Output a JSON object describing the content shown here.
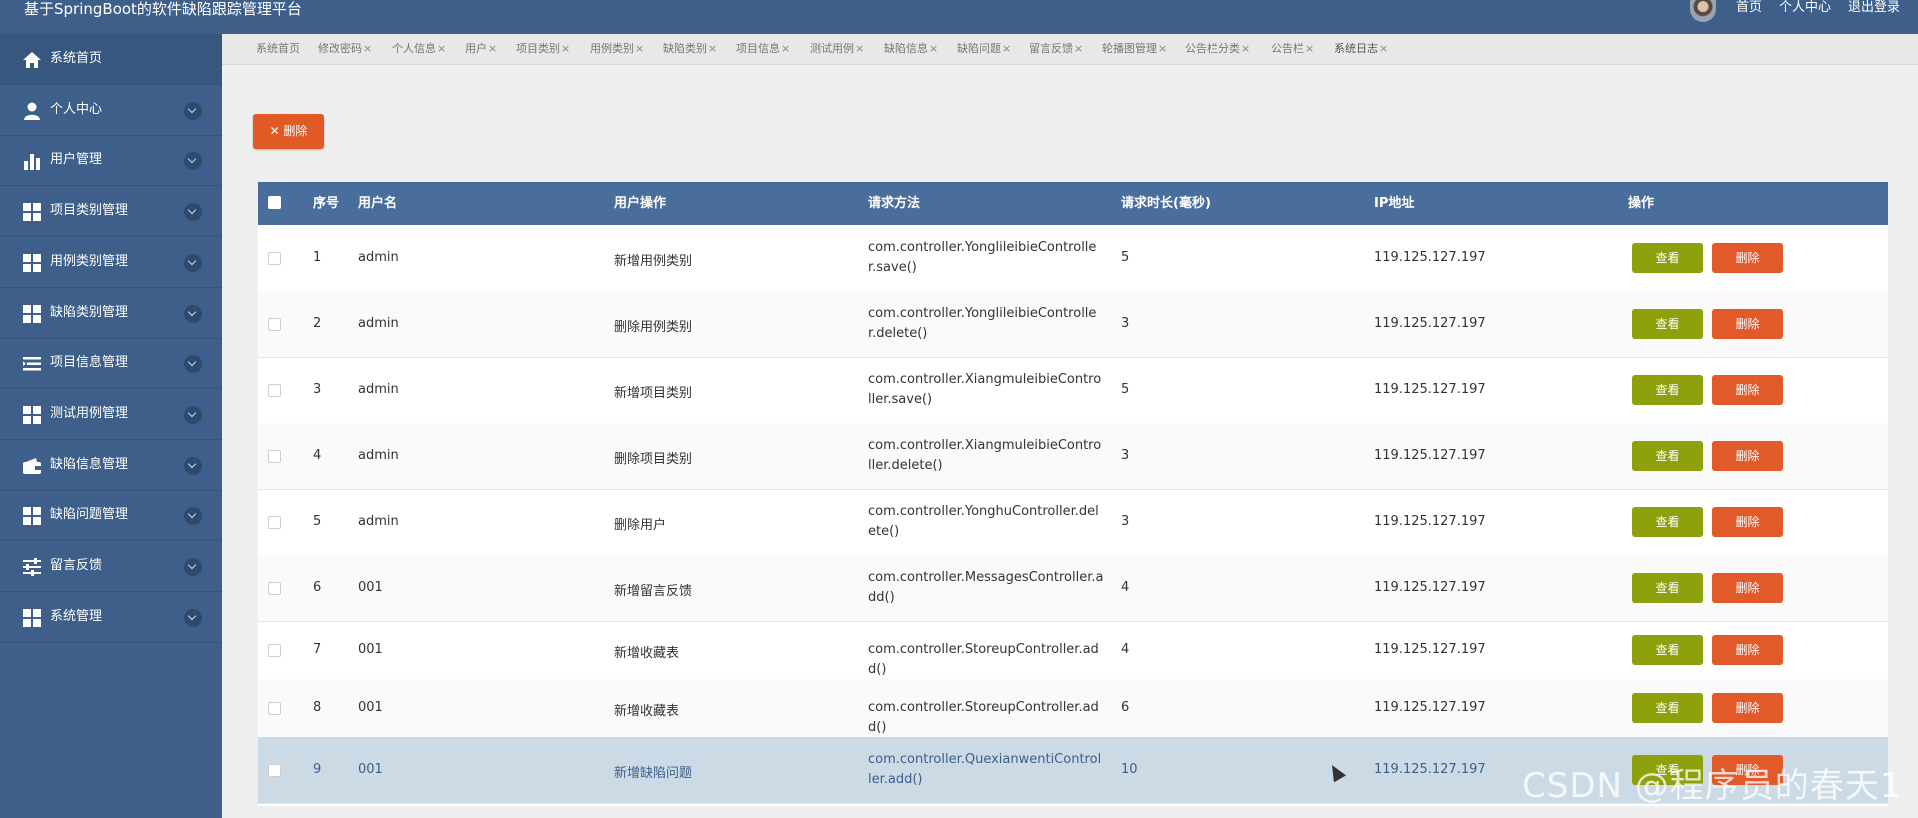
{
  "app": {
    "title": "基于SpringBoot的软件缺陷跟踪管理平台"
  },
  "topnav": {
    "home": "首页",
    "profile": "个人中心",
    "logout": "退出登录"
  },
  "sidebar": {
    "items": [
      {
        "label": "系统首页",
        "icon": "home-icon"
      },
      {
        "label": "个人中心",
        "icon": "person-icon"
      },
      {
        "label": "用户管理",
        "icon": "bar-chart-icon"
      },
      {
        "label": "项目类别管理",
        "icon": "grid-icon"
      },
      {
        "label": "用例类别管理",
        "icon": "grid-icon"
      },
      {
        "label": "缺陷类别管理",
        "icon": "grid-icon"
      },
      {
        "label": "项目信息管理",
        "icon": "list-icon"
      },
      {
        "label": "测试用例管理",
        "icon": "grid-icon"
      },
      {
        "label": "缺陷信息管理",
        "icon": "wallet-icon"
      },
      {
        "label": "缺陷问题管理",
        "icon": "grid-icon"
      },
      {
        "label": "留言反馈",
        "icon": "sliders-icon"
      },
      {
        "label": "系统管理",
        "icon": "grid-icon"
      }
    ]
  },
  "tabs": [
    {
      "label": "系统首页",
      "close": ""
    },
    {
      "label": "修改密码",
      "close": "×"
    },
    {
      "label": "个人信息",
      "close": "×"
    },
    {
      "label": "用户",
      "close": "×"
    },
    {
      "label": "项目类别",
      "close": "×"
    },
    {
      "label": "用例类别",
      "close": "×"
    },
    {
      "label": "缺陷类别",
      "close": "×"
    },
    {
      "label": "项目信息",
      "close": "×"
    },
    {
      "label": "测试用例",
      "close": "×"
    },
    {
      "label": "缺陷信息",
      "close": "×"
    },
    {
      "label": "缺陷问题",
      "close": "×"
    },
    {
      "label": "留言反馈",
      "close": "×"
    },
    {
      "label": "轮播图管理",
      "close": "×"
    },
    {
      "label": "公告栏分类",
      "close": "×"
    },
    {
      "label": "公告栏",
      "close": "×"
    },
    {
      "label": "系统日志",
      "close": "×"
    }
  ],
  "toolbar": {
    "delete_label": "✕ 删除"
  },
  "table": {
    "headers": {
      "index": "序号",
      "username": "用户名",
      "operation": "用户操作",
      "method": "请求方法",
      "duration": "请求时长(毫秒)",
      "ip": "IP地址",
      "actions": "操作"
    },
    "view_label": "查看",
    "delete_label": "删除",
    "rows": [
      {
        "index": "1",
        "username": "admin",
        "operation": "新增用例类别",
        "method": "com.controller.YonglileibieController.save()",
        "duration": "5",
        "ip": "119.125.127.197"
      },
      {
        "index": "2",
        "username": "admin",
        "operation": "删除用例类别",
        "method": "com.controller.YonglileibieController.delete()",
        "duration": "3",
        "ip": "119.125.127.197"
      },
      {
        "index": "3",
        "username": "admin",
        "operation": "新增项目类别",
        "method": "com.controller.XiangmuleibieController.save()",
        "duration": "5",
        "ip": "119.125.127.197"
      },
      {
        "index": "4",
        "username": "admin",
        "operation": "删除项目类别",
        "method": "com.controller.XiangmuleibieController.delete()",
        "duration": "3",
        "ip": "119.125.127.197"
      },
      {
        "index": "5",
        "username": "admin",
        "operation": "删除用户",
        "method": "com.controller.YonghuController.delete()",
        "duration": "3",
        "ip": "119.125.127.197"
      },
      {
        "index": "6",
        "username": "001",
        "operation": "新增留言反馈",
        "method": "com.controller.MessagesController.add()",
        "duration": "4",
        "ip": "119.125.127.197"
      },
      {
        "index": "7",
        "username": "001",
        "operation": "新增收藏表",
        "method": "com.controller.StoreupController.add()",
        "duration": "4",
        "ip": "119.125.127.197"
      },
      {
        "index": "8",
        "username": "001",
        "operation": "新增收藏表",
        "method": "com.controller.StoreupController.add()",
        "duration": "6",
        "ip": "119.125.127.197"
      },
      {
        "index": "9",
        "username": "001",
        "operation": "新增缺陷问题",
        "method": "com.controller.QuexianwentiController.add()",
        "duration": "10",
        "ip": "119.125.127.197"
      }
    ]
  },
  "watermark": "CSDN @程序员的春天1"
}
